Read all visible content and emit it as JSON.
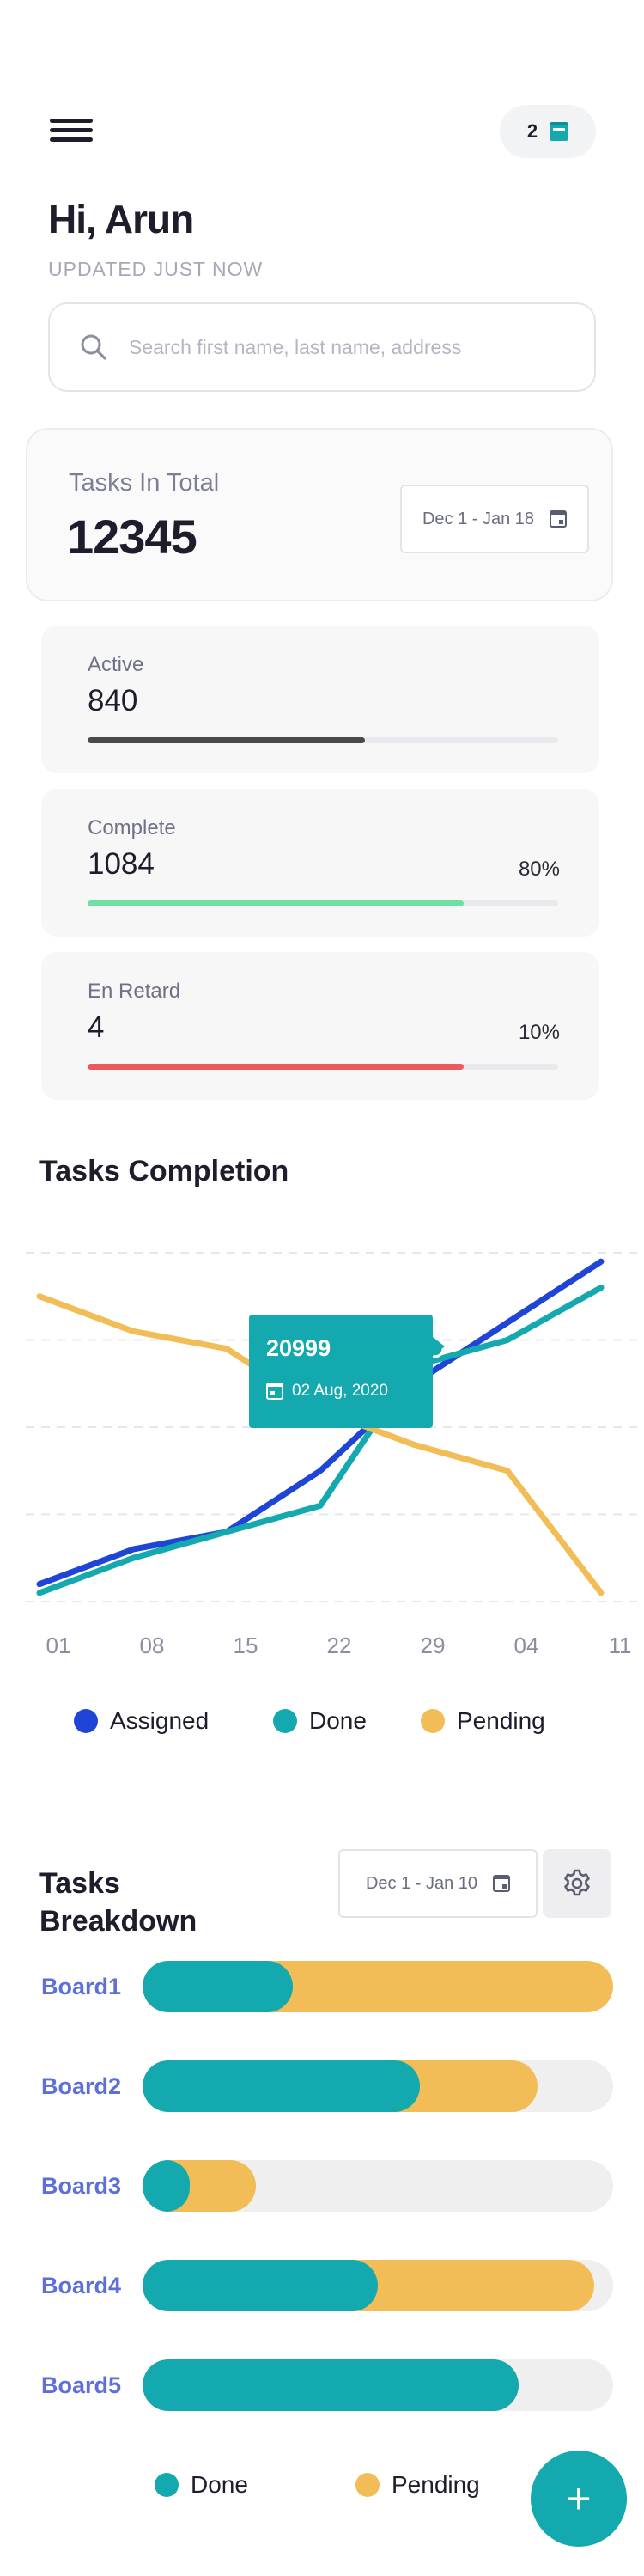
{
  "header": {
    "notification_count": "2",
    "notification_icon": "inbox-icon",
    "menu_icon": "hamburger-icon"
  },
  "greeting": "Hi, Arun",
  "updated_label": "UPDATED JUST NOW",
  "search": {
    "placeholder": "Search first name, last name, address",
    "value": ""
  },
  "total": {
    "label": "Tasks In Total",
    "value": "12345",
    "date_range": "Dec 1 - Jan 18"
  },
  "stats": [
    {
      "label": "Active",
      "value": "840",
      "percent_text": "",
      "progress": 0.59,
      "color": "#4a4a4a"
    },
    {
      "label": "Complete",
      "value": "1084",
      "percent_text": "80%",
      "progress": 0.8,
      "color": "#6ee0a1"
    },
    {
      "label": "En Retard",
      "value": "4",
      "percent_text": "10%",
      "progress": 0.8,
      "color": "#ec5a5a"
    }
  ],
  "completion": {
    "title": "Tasks Completion",
    "tooltip": {
      "value": "20999",
      "date": "02 Aug, 2020"
    }
  },
  "chart_data": {
    "type": "line",
    "title": "Tasks Completion",
    "x": [
      "01",
      "08",
      "15",
      "22",
      "29",
      "04",
      "11"
    ],
    "ylim": [
      0,
      4
    ],
    "grid": true,
    "legend_position": "bottom",
    "series": [
      {
        "name": "Assigned",
        "color": "#1f45d6",
        "values": [
          0.2,
          0.6,
          0.8,
          1.5,
          2.5,
          3.2,
          3.9
        ]
      },
      {
        "name": "Done",
        "color": "#13a9ae",
        "values": [
          0.1,
          0.5,
          0.8,
          1.1,
          2.7,
          3.0,
          3.6
        ]
      },
      {
        "name": "Pending",
        "color": "#f2bd57",
        "values": [
          3.5,
          3.1,
          2.9,
          2.2,
          1.8,
          1.5,
          0.1
        ]
      }
    ]
  },
  "breakdown": {
    "title": "Tasks Breakdown",
    "date_range": "Dec 1 - Jan 10",
    "boards": [
      {
        "name": "Board1",
        "done": 0.32,
        "pending": 1.0
      },
      {
        "name": "Board2",
        "done": 0.59,
        "pending": 0.84
      },
      {
        "name": "Board3",
        "done": 0.1,
        "pending": 0.24
      },
      {
        "name": "Board4",
        "done": 0.5,
        "pending": 0.96
      },
      {
        "name": "Board5",
        "done": 0.8,
        "pending": 0.8
      }
    ],
    "legend": [
      {
        "name": "Done",
        "color": "#13a9ae"
      },
      {
        "name": "Pending",
        "color": "#f2bd57"
      }
    ]
  },
  "fab": {
    "label": "+"
  }
}
